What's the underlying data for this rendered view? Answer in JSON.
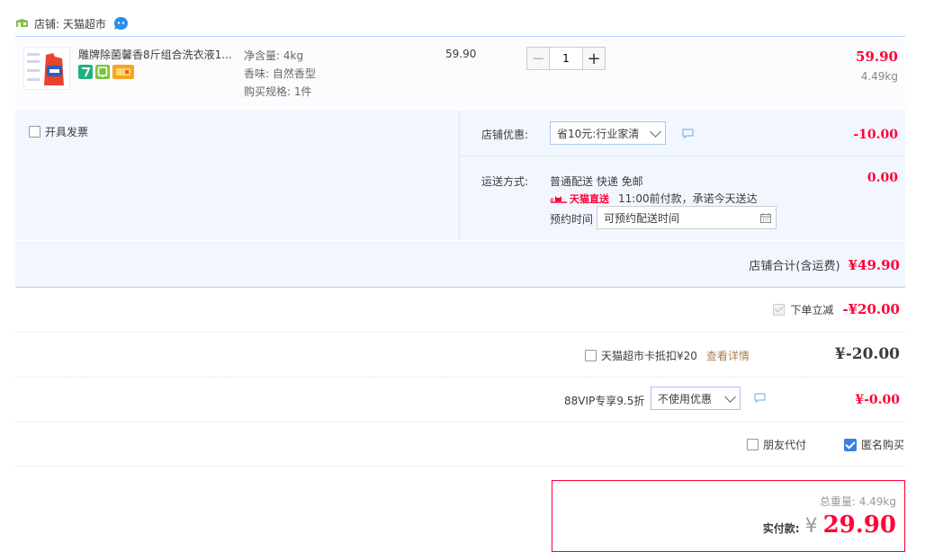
{
  "shop": {
    "label": "店铺: 天猫超市"
  },
  "item": {
    "title": "雕牌除菌馨香8斤组合洗衣液1...",
    "net_weight": "净含量: 4kg",
    "scent": "香味: 自然香型",
    "spec": "购买规格: 1件",
    "unit_price": "59.90",
    "quantity": "1",
    "minus_label": "−",
    "plus_label": "+",
    "subtotal": "59.90",
    "weight": "4.49kg"
  },
  "invoice": {
    "label": "开具发票"
  },
  "shop_discount": {
    "label": "店铺优惠:",
    "selected": "省10元:行业家清",
    "amount": "-10.00"
  },
  "shipping": {
    "label": "运送方式:",
    "method": "普通配送 快递 免邮",
    "tmall_brand": "天猫直送",
    "promise": "11:00前付款，承诺今天送达",
    "schedule_label": "预约时间",
    "schedule_value": "可预约配送时间",
    "amount": "0.00"
  },
  "shop_total": {
    "label": "店铺合计(含运费)",
    "amount": "¥49.90"
  },
  "instant_reduce": {
    "label": "下单立减",
    "amount": "-¥20.00"
  },
  "card_deduct": {
    "label": "天猫超市卡抵扣¥20",
    "link": "查看详情",
    "amount": "¥-20.00"
  },
  "vip": {
    "label": "88VIP专享9.5折",
    "selected": "不使用优惠",
    "amount": "¥-0.00"
  },
  "pay_options": {
    "friend_pay": "朋友代付",
    "anonymous": "匿名购买"
  },
  "summary": {
    "weight_label": "总重量:",
    "weight_value": "4.49kg",
    "pay_label": "实付款:",
    "currency": "¥",
    "pay_amount": "29.90"
  },
  "colors": {
    "accent_red": "#ff0036",
    "panel_blue": "#f2f7ff",
    "border_blue": "#b2d1ff",
    "check_blue": "#3b7ee6"
  },
  "icons": [
    "shop-icon",
    "wangwang-icon",
    "minus-icon",
    "plus-icon",
    "chevron-down-icon",
    "message-icon",
    "calendar-icon",
    "tmall-cat-icon"
  ]
}
